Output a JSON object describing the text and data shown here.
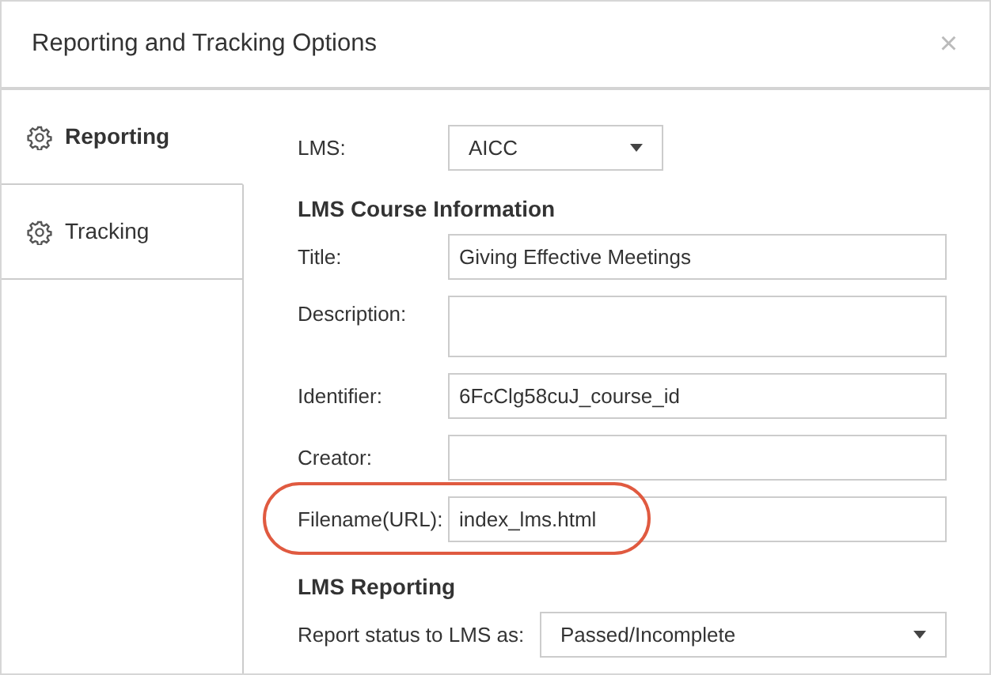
{
  "dialog": {
    "title": "Reporting and Tracking Options",
    "close": "×"
  },
  "sidebar": {
    "items": [
      {
        "label": "Reporting",
        "selected": true
      },
      {
        "label": "Tracking",
        "selected": false
      }
    ]
  },
  "lms": {
    "label": "LMS:",
    "value": "AICC"
  },
  "sections": [
    {
      "heading": "LMS Course Information",
      "fields": [
        {
          "label": "Title:",
          "value": "Giving Effective Meetings",
          "kind": "input",
          "highlighted": false
        },
        {
          "label": "Description:",
          "kind": "textarea",
          "highlighted": false
        },
        {
          "label": "Identifier:",
          "value": "6FcClg58cuJ_course_id",
          "kind": "input",
          "highlighted": false
        },
        {
          "label": "Creator:",
          "kind": "input",
          "highlighted": false
        },
        {
          "label": "Filename(URL):",
          "value": "index_lms.html",
          "kind": "input",
          "highlighted": true
        }
      ]
    },
    {
      "heading": "LMS Reporting",
      "fields": [
        {
          "label": "Report status to LMS as:",
          "value": "Passed/Incomplete",
          "kind": "select",
          "highlighted": false
        }
      ]
    }
  ]
}
